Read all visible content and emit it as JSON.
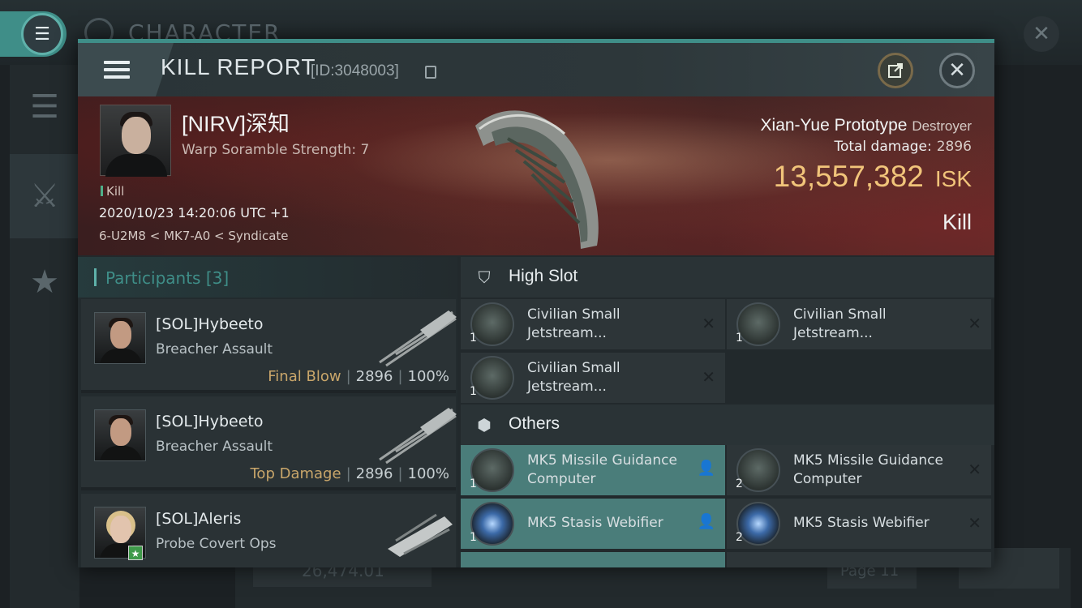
{
  "background": {
    "title": "CHARACTER",
    "footer_value": "26,474.01",
    "footer_page": "Page 11"
  },
  "header": {
    "title": "KILL REPORT",
    "report_id": "[ID:3048003]"
  },
  "victim": {
    "name": "[NIRV]深知",
    "subtitle": "Warp Soramble Strength: 7",
    "kill_tag": "Kill",
    "datetime": "2020/10/23 14:20:06 UTC +1",
    "location": "6-U2M8 < MK7-A0 < Syndicate",
    "ship_name": "Xian-Yue Prototype",
    "ship_class": "Destroyer",
    "total_damage_label": "Total damage:",
    "total_damage": "2896",
    "isk_value": "13,557,382",
    "isk_unit": "ISK",
    "result": "Kill"
  },
  "participants": {
    "title": "Participants",
    "count": "[3]",
    "rows": [
      {
        "name": "[SOL]Hybeeto",
        "ship": "Breacher Assault",
        "tag": "Final Blow",
        "damage": "2896",
        "percent": "100%"
      },
      {
        "name": "[SOL]Hybeeto",
        "ship": "Breacher Assault",
        "tag": "Top Damage",
        "damage": "2896",
        "percent": "100%"
      },
      {
        "name": "[SOL]Aleris",
        "ship": "Probe Covert Ops",
        "tag": "",
        "damage": "",
        "percent": ""
      }
    ]
  },
  "slots": {
    "high_slot": {
      "title": "High Slot",
      "modules": [
        {
          "name": "Civilian Small Jetstream...",
          "qty": "1",
          "state": "destroyed"
        },
        {
          "name": "Civilian Small Jetstream...",
          "qty": "1",
          "state": "destroyed"
        },
        {
          "name": "Civilian Small Jetstream...",
          "qty": "1",
          "state": "destroyed"
        }
      ]
    },
    "others": {
      "title": "Others",
      "modules": [
        {
          "name": "MK5 Missile Guidance Computer",
          "qty": "1",
          "state": "dropped"
        },
        {
          "name": "MK5 Missile Guidance Computer",
          "qty": "2",
          "state": "destroyed"
        },
        {
          "name": "MK5 Stasis Webifier",
          "qty": "1",
          "state": "dropped"
        },
        {
          "name": "MK5 Stasis Webifier",
          "qty": "2",
          "state": "destroyed"
        }
      ]
    }
  },
  "colors": {
    "accent": "#3f8e88",
    "isk": "#f1c47a",
    "tag_gold": "#c9a66a",
    "dropped_highlight": "#4a7d7a"
  },
  "icons": {
    "destroyed": "close-icon",
    "dropped": "person-icon",
    "share": "external-link-icon",
    "close": "close-icon",
    "high_slot": "shield-icon",
    "others": "cube-icon"
  }
}
